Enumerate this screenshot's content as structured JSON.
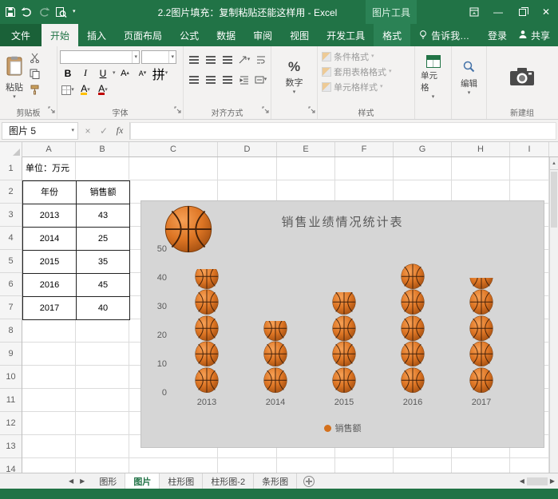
{
  "title_bar": {
    "title": "2.2图片填充：复制粘贴还能这样用 - Excel",
    "contextual_label": "图片工具"
  },
  "ribbon_tabs": {
    "file": "文件",
    "tabs": [
      "开始",
      "插入",
      "页面布局",
      "公式",
      "数据",
      "审阅",
      "视图",
      "开发工具",
      "格式"
    ],
    "active": "开始",
    "tell_me": "告诉我…",
    "sign_in": "登录",
    "share": "共享"
  },
  "ribbon": {
    "paste_label": "粘贴",
    "clipboard_label": "剪贴板",
    "font_label": "字体",
    "bold": "B",
    "italic": "I",
    "underline": "U",
    "font_color_letter": "A",
    "fill_letter": "A",
    "phonetic": "拼",
    "align_label": "对齐方式",
    "number_label": "数字",
    "number_symbol": "%",
    "styles_label": "样式",
    "styles_items": [
      "条件格式",
      "套用表格格式",
      "单元格样式"
    ],
    "cells_label": "单元格",
    "editing_label": "编辑",
    "new_group_label": "新建组"
  },
  "formula_bar": {
    "name_box": "图片 5",
    "formula": "",
    "fx": "fx",
    "cancel": "×",
    "enter": "✓"
  },
  "grid": {
    "col_headers": [
      "A",
      "B",
      "C",
      "D",
      "E",
      "F",
      "G",
      "H",
      "I"
    ],
    "row_headers": [
      "1",
      "2",
      "3",
      "4",
      "5",
      "6",
      "7",
      "8",
      "9",
      "10",
      "11",
      "12",
      "13",
      "14"
    ],
    "a1": "单位：万元",
    "table": {
      "headers": [
        "年份",
        "销售额"
      ],
      "rows": [
        [
          "2013",
          "43"
        ],
        [
          "2014",
          "25"
        ],
        [
          "2015",
          "35"
        ],
        [
          "2016",
          "45"
        ],
        [
          "2017",
          "40"
        ]
      ]
    }
  },
  "chart_data": {
    "type": "bar",
    "title": "销售业绩情况统计表",
    "categories": [
      "2013",
      "2014",
      "2015",
      "2016",
      "2017"
    ],
    "series": [
      {
        "name": "销售额",
        "values": [
          43,
          25,
          35,
          45,
          40
        ]
      }
    ],
    "xlabel": "",
    "ylabel": "",
    "ylim": [
      0,
      50
    ],
    "yticks": [
      0,
      10,
      20,
      30,
      40,
      50
    ],
    "legend_position": "bottom",
    "legend_label": "销售额",
    "fill_style": "basketball-picture-stack",
    "units_per_picture": 9,
    "background": "#d6d6d6",
    "accent_color": "#d4701c"
  },
  "sheet_tabs": {
    "tabs": [
      "图形",
      "图片",
      "柱形图",
      "柱形图-2",
      "条形图"
    ],
    "active": "图片"
  }
}
